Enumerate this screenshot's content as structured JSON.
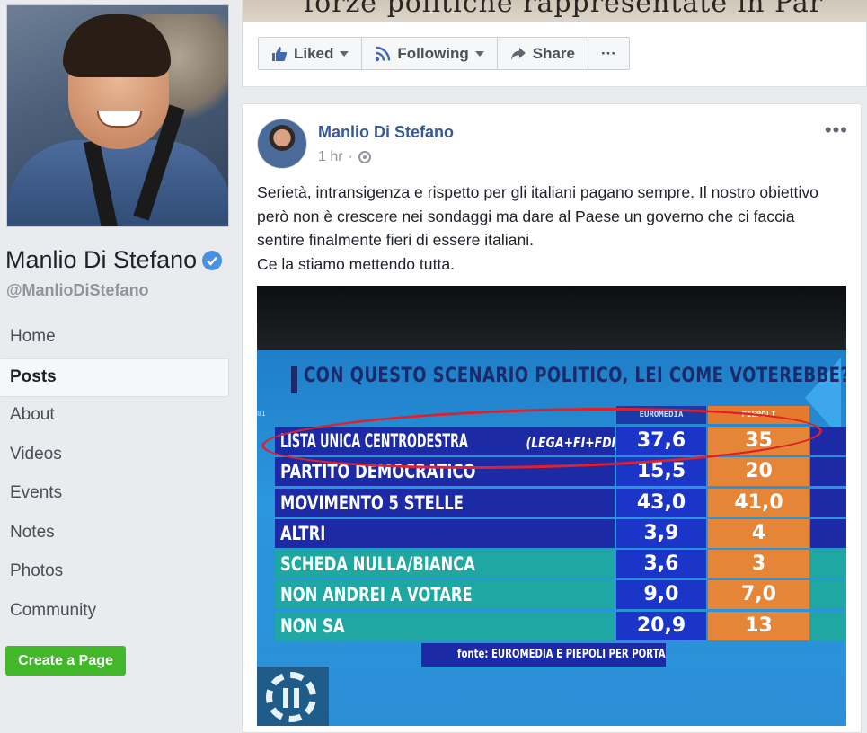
{
  "sidebar": {
    "page_name": "Manlio Di Stefano",
    "handle": "@ManlioDiStefano",
    "nav": [
      "Home",
      "Posts",
      "About",
      "Videos",
      "Events",
      "Notes",
      "Photos",
      "Community"
    ],
    "active_item": "Posts",
    "create_page": "Create a Page"
  },
  "top_card": {
    "newspaper_text": "forze politiche rappresentate in Par",
    "actions": {
      "liked": "Liked",
      "following": "Following",
      "share": "Share",
      "more": "···"
    }
  },
  "post": {
    "author": "Manlio Di Stefano",
    "time": "1 hr",
    "menu": "•••",
    "text": "Serietà, intransigenza e rispetto per gli italiani pagano sempre. Il nostro obiettivo però non è crescere nei sondaggi ma dare al Paese un governo che ci faccia sentire finalmente fieri di essere italiani.\nCe la stiamo mettendo tutta."
  },
  "poll": {
    "title": "CON QUESTO SCENARIO POLITICO, LEI COME VOTEREBBE?",
    "col_euromedia": "EUROMEDIA",
    "col_piepoli": "PIEPOLI",
    "row_index": "01",
    "rows": [
      {
        "label": "LISTA UNICA CENTRODESTRA",
        "sub": "(LEGA+FI+FDI)",
        "euromedia": "37,6",
        "piepoli": "35"
      },
      {
        "label": "PARTITO DEMOCRATICO",
        "sub": "",
        "euromedia": "15,5",
        "piepoli": "20"
      },
      {
        "label": "MOVIMENTO 5 STELLE",
        "sub": "",
        "euromedia": "43,0",
        "piepoli": "41,0"
      },
      {
        "label": "ALTRI",
        "sub": "",
        "euromedia": "3,9",
        "piepoli": "4"
      },
      {
        "label": "SCHEDA NULLA/BIANCA",
        "sub": "",
        "euromedia": "3,6",
        "piepoli": "3"
      },
      {
        "label": "NON ANDREI A VOTARE",
        "sub": "",
        "euromedia": "9,0",
        "piepoli": "7,0"
      },
      {
        "label": "NON SA",
        "sub": "",
        "euromedia": "20,9",
        "piepoli": "13"
      }
    ],
    "source": "fonte: EUROMEDIA E PIEPOLI PER PORTA A PORTA",
    "highlighted_row": 0
  },
  "colors": {
    "facebook_blue": "#385898",
    "create_green": "#42b72a",
    "poll_navy": "#1d2aa6",
    "poll_teal": "#1fa7a3",
    "poll_orange": "#e58537",
    "highlight_red": "#e0202a"
  },
  "icons": {
    "verified": "verified-check-icon",
    "liked": "thumbs-up-icon",
    "following": "rss-icon",
    "share": "share-arrow-icon",
    "privacy": "globe-icon"
  }
}
